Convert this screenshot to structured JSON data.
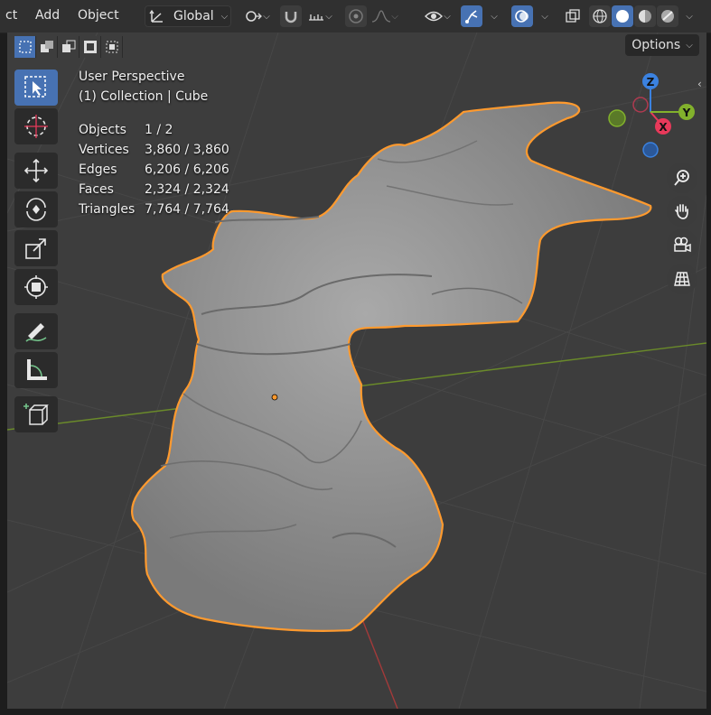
{
  "header": {
    "menu": [
      "ct",
      "Add",
      "Object"
    ],
    "orientation": "Global"
  },
  "options_label": "Options",
  "overlay": {
    "view_name": "User Perspective",
    "collection_line": "(1) Collection | Cube",
    "stats": [
      {
        "label": "Objects",
        "value": "1 / 2"
      },
      {
        "label": "Vertices",
        "value": "3,860 / 3,860"
      },
      {
        "label": "Edges",
        "value": "6,206 / 6,206"
      },
      {
        "label": "Faces",
        "value": "2,324 / 2,324"
      },
      {
        "label": "Triangles",
        "value": "7,764 / 7,764"
      }
    ]
  },
  "gizmo": {
    "z": "Z",
    "x": "X",
    "y": "Y"
  },
  "colors": {
    "accent": "#4772b3",
    "selection_outline": "#ff9a2e",
    "axis_x": "#e8395a",
    "axis_y": "#82b12c",
    "axis_z": "#3b82e0"
  },
  "tools": [
    "select-box",
    "cursor",
    "move",
    "rotate",
    "scale",
    "transform",
    "annotate",
    "measure",
    "add-cube"
  ],
  "nav_buttons": [
    "zoom",
    "pan",
    "camera",
    "ortho-grid"
  ]
}
